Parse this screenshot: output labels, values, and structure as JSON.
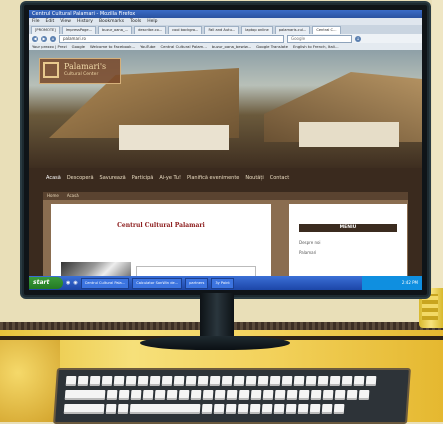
{
  "browser": {
    "title": "Centrul Cultural Palamari - Mozilla Firefox",
    "menu": [
      "File",
      "Edit",
      "View",
      "History",
      "Bookmarks",
      "Tools",
      "Help"
    ],
    "tabs": [
      "[PROMOTE]",
      "ImpressPage...",
      "buzur_oana_...",
      "describe.co...",
      "cool backgro...",
      "Fall and Autu...",
      "laptop online",
      "palamaris.cul...",
      "Central C..."
    ],
    "url": "palamari.ro",
    "search_placeholder": "Google",
    "bookmarks": [
      "Your prezzo | Prezi",
      "Google",
      "Welcome to Facebook...",
      "YouTube",
      "Central Cultural Palam...",
      "buzur_oana_bewiw...",
      "Google Translate",
      "English to French, Itali..."
    ]
  },
  "site": {
    "logo_name": "Palamari's",
    "logo_sub": "Cultural Center",
    "nav": [
      "Acasă",
      "Descoperă",
      "Savurează",
      "Participă",
      "Ai-ye Tu!",
      "Planifică evenimente",
      "Noutăți",
      "Contact"
    ],
    "crumbs": [
      "Home",
      "Acasă"
    ],
    "article_title": "Centrul Cultural Palamari",
    "sidebar_title": "MENIU",
    "sidebar_items": [
      "Despre noi",
      "Palamari"
    ]
  },
  "taskbar": {
    "start": "start",
    "tasks": [
      "Centrul Cultural Pala...",
      "Calculator SonWin de...",
      "partners",
      "3y Paint"
    ],
    "clock": "2:42 PM"
  }
}
